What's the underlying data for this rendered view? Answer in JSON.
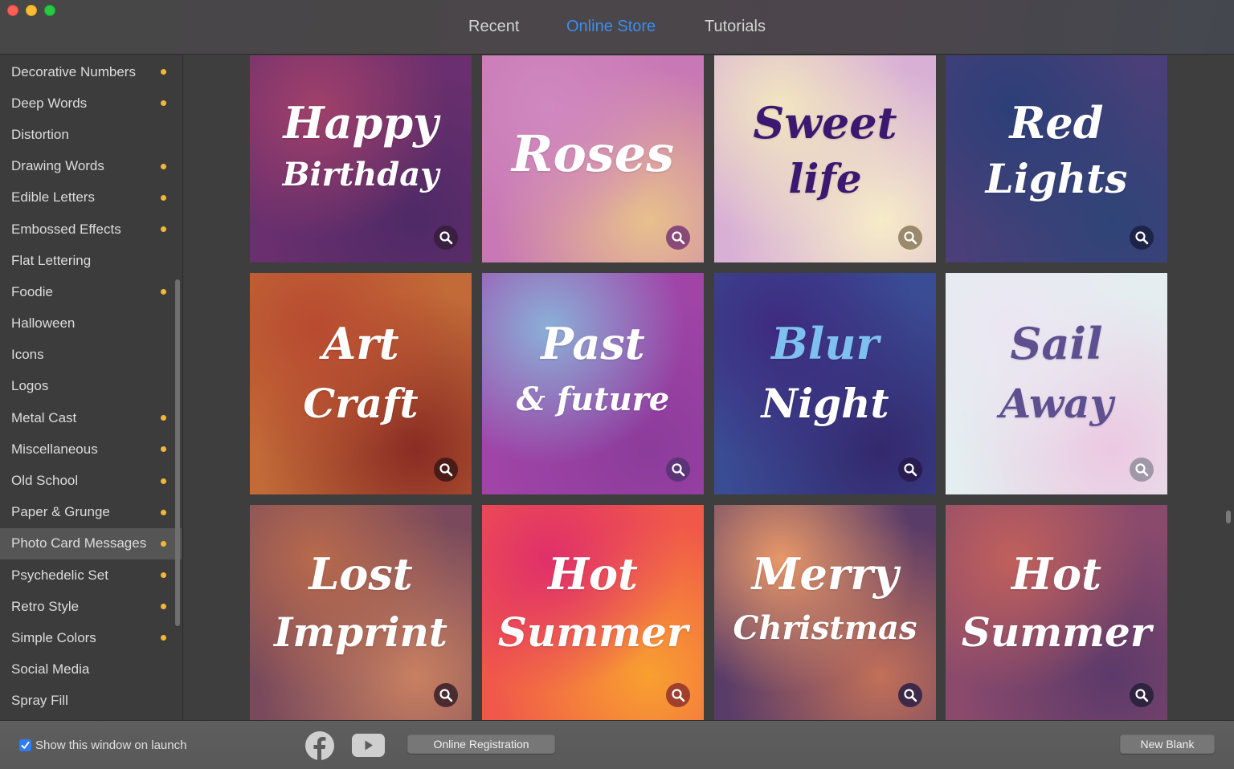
{
  "window": {
    "controls": [
      "close",
      "minimize",
      "maximize"
    ]
  },
  "tabs": [
    {
      "label": "Recent",
      "active": false
    },
    {
      "label": "Online Store",
      "active": true
    },
    {
      "label": "Tutorials",
      "active": false
    }
  ],
  "accent_color": "#3b8df0",
  "new_badge_color": "#f0b838",
  "sidebar": {
    "items": [
      {
        "label": "Decorative Numbers",
        "new": true,
        "selected": false
      },
      {
        "label": "Deep Words",
        "new": true,
        "selected": false
      },
      {
        "label": "Distortion",
        "new": false,
        "selected": false
      },
      {
        "label": "Drawing Words",
        "new": true,
        "selected": false
      },
      {
        "label": "Edible Letters",
        "new": true,
        "selected": false
      },
      {
        "label": "Embossed Effects",
        "new": true,
        "selected": false
      },
      {
        "label": "Flat Lettering",
        "new": false,
        "selected": false
      },
      {
        "label": "Foodie",
        "new": true,
        "selected": false
      },
      {
        "label": "Halloween",
        "new": false,
        "selected": false
      },
      {
        "label": "Icons",
        "new": false,
        "selected": false
      },
      {
        "label": "Logos",
        "new": false,
        "selected": false
      },
      {
        "label": "Metal Cast",
        "new": true,
        "selected": false
      },
      {
        "label": "Miscellaneous",
        "new": true,
        "selected": false
      },
      {
        "label": "Old School",
        "new": true,
        "selected": false
      },
      {
        "label": "Paper & Grunge",
        "new": true,
        "selected": false
      },
      {
        "label": "Photo Card Messages",
        "new": true,
        "selected": true
      },
      {
        "label": "Psychedelic Set",
        "new": true,
        "selected": false
      },
      {
        "label": "Retro Style",
        "new": true,
        "selected": false
      },
      {
        "label": "Simple Colors",
        "new": true,
        "selected": false
      },
      {
        "label": "Social Media",
        "new": false,
        "selected": false
      },
      {
        "label": "Spray Fill",
        "new": false,
        "selected": false
      }
    ]
  },
  "templates": [
    {
      "line1": "Happy",
      "line2": "Birthday",
      "text_color": "#ffffff",
      "line1_color": "#ffffff",
      "bg": [
        "#a0406a",
        "#6a2f6e",
        "#4e2a66"
      ],
      "zoom_bg": "#3a1f40"
    },
    {
      "line1": "Roses",
      "line2": "",
      "text_color": "#ffffff",
      "line1_color": "#ffffff",
      "bg": [
        "#d088c0",
        "#c878b4",
        "#e8c08c"
      ],
      "zoom_bg": "#8a4a78"
    },
    {
      "line1": "Sweet",
      "line2": "life",
      "text_color": "#3d1870",
      "line1_color": "#3d1870",
      "bg": [
        "#f2e6c0",
        "#d8b0d6",
        "#f6ecc8"
      ],
      "zoom_bg": "#9a8a6a"
    },
    {
      "line1": "Red",
      "line2": "Lights",
      "text_color": "#ffffff",
      "line1_color": "#ffffff",
      "bg": [
        "#2c3f78",
        "#4a3f78",
        "#2e4478"
      ],
      "zoom_bg": "#1e2448"
    },
    {
      "line1": "Art",
      "line2": "Craft",
      "text_color": "#ffffff",
      "line1_color": "#ffffff",
      "bg": [
        "#b84a30",
        "#c26a38",
        "#8a2c24"
      ],
      "zoom_bg": "#4a1c18"
    },
    {
      "line1": "Past",
      "line2": "& future",
      "text_color": "#ffffff",
      "line1_color": "#ffffff",
      "bg": [
        "#8ab0d8",
        "#a044a8",
        "#8c3c9c"
      ],
      "zoom_bg": "#5c3478"
    },
    {
      "line1": "Blur",
      "line2": "Night",
      "text_color": "#ffffff",
      "line1_color": "#7ec0f0",
      "bg": [
        "#3e2a7e",
        "#3a4c94",
        "#34286e"
      ],
      "zoom_bg": "#281c50"
    },
    {
      "line1": "Sail",
      "line2": "Away",
      "text_color": "#5e5090",
      "line1_color": "#5e5090",
      "bg": [
        "#ece6f2",
        "#e4eef0",
        "#ecc8e2"
      ],
      "zoom_bg": "#a098a8"
    },
    {
      "line1": "Lost",
      "line2": "Imprint",
      "text_color": "#ffffff",
      "line1_color": "#ffffff",
      "bg": [
        "#b86a4c",
        "#7a4a5c",
        "#c88060"
      ],
      "zoom_bg": "#4a2c30"
    },
    {
      "line1": "Hot",
      "line2": "Summer",
      "text_color": "#ffffff",
      "line1_color": "#ffffff",
      "bg": [
        "#e0306a",
        "#f0584a",
        "#f8a030"
      ],
      "zoom_bg": "#a0402c"
    },
    {
      "line1": "Merry",
      "line2": "Christmas",
      "text_color": "#ffffff",
      "line1_color": "#ffffff",
      "bg": [
        "#e89868",
        "#5a3c68",
        "#c27058"
      ],
      "zoom_bg": "#3c2a48"
    },
    {
      "line1": "Hot",
      "line2": "Summer",
      "text_color": "#ffffff",
      "line1_color": "#ffffff",
      "bg": [
        "#c0605c",
        "#8a4a6c",
        "#5c3a6a"
      ],
      "zoom_bg": "#2e2440"
    }
  ],
  "footer": {
    "show_on_launch_label": "Show this window on launch",
    "show_on_launch_checked": true,
    "social": [
      "facebook",
      "youtube"
    ],
    "register_label": "Online Registration",
    "new_blank_label": "New Blank"
  }
}
